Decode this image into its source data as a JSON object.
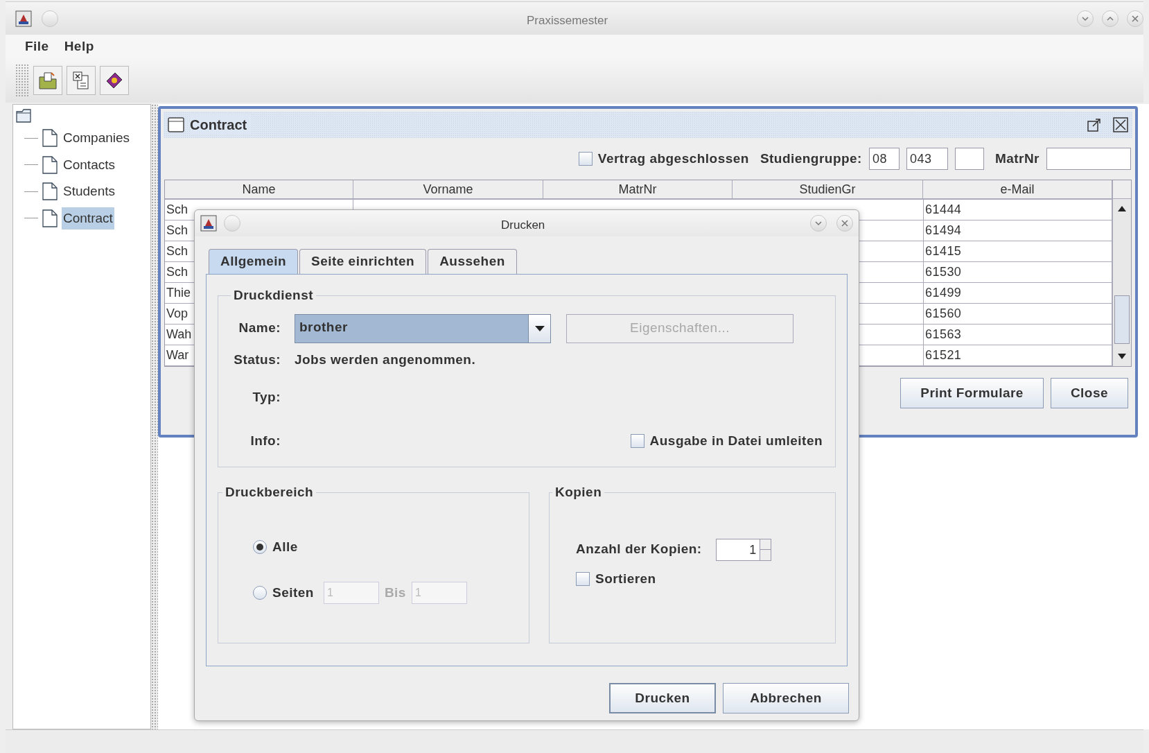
{
  "window": {
    "title": "Praxissemester"
  },
  "menu": [
    "File",
    "Help"
  ],
  "tree": {
    "items": [
      {
        "label": "Companies",
        "selected": false
      },
      {
        "label": "Contacts",
        "selected": false
      },
      {
        "label": "Students",
        "selected": false
      },
      {
        "label": "Contract",
        "selected": true
      }
    ]
  },
  "contract": {
    "title": "Contract",
    "filter": {
      "checkbox_label": "Vertrag abgeschlossen",
      "checked": false,
      "group_label": "Studiengruppe:",
      "group_fields": [
        "08",
        "043"
      ],
      "matrnr_label": "MatrNr"
    },
    "table": {
      "columns": [
        "Name",
        "Vorname",
        "MatrNr",
        "StudienGr",
        "e-Mail"
      ],
      "rows": [
        {
          "name": "Sch",
          "email": "61444"
        },
        {
          "name": "Sch",
          "email": "61494"
        },
        {
          "name": "Sch",
          "email": "61415"
        },
        {
          "name": "Sch",
          "email": "61530"
        },
        {
          "name": "Thie",
          "email": "61499"
        },
        {
          "name": "Vop",
          "email": "61560"
        },
        {
          "name": "Wah",
          "email": "61563"
        },
        {
          "name": "War",
          "email": "61521"
        }
      ]
    },
    "buttons": [
      "Print Formulare",
      "Close"
    ]
  },
  "dialog": {
    "title": "Drucken",
    "tabs": [
      {
        "label": "Allgemein",
        "selected": true
      },
      {
        "label": "Seite einrichten",
        "selected": false
      },
      {
        "label": "Aussehen",
        "selected": false
      }
    ],
    "service": {
      "title": "Druckdienst",
      "name_label": "Name:",
      "printer": "brother",
      "properties_button": {
        "label": "Eigenschaften...",
        "disabled": true
      },
      "status_label": "Status:",
      "status": "Jobs werden angenommen.",
      "type_label": "Typ:",
      "info_label": "Info:",
      "file_checkbox": {
        "label": "Ausgabe in Datei umleiten",
        "checked": false
      }
    },
    "range": {
      "title": "Druckbereich",
      "options": [
        {
          "label": "Alle",
          "selected": true
        },
        {
          "label": "Seiten",
          "selected": false
        }
      ],
      "from": "1",
      "to_label": "Bis",
      "to": "1",
      "pages_disabled": true
    },
    "copies": {
      "title": "Kopien",
      "label": "Anzahl der Kopien:",
      "value": "1",
      "sort": {
        "label": "Sortieren",
        "checked": false
      }
    },
    "buttons": [
      "Drucken",
      "Abbrechen"
    ]
  }
}
